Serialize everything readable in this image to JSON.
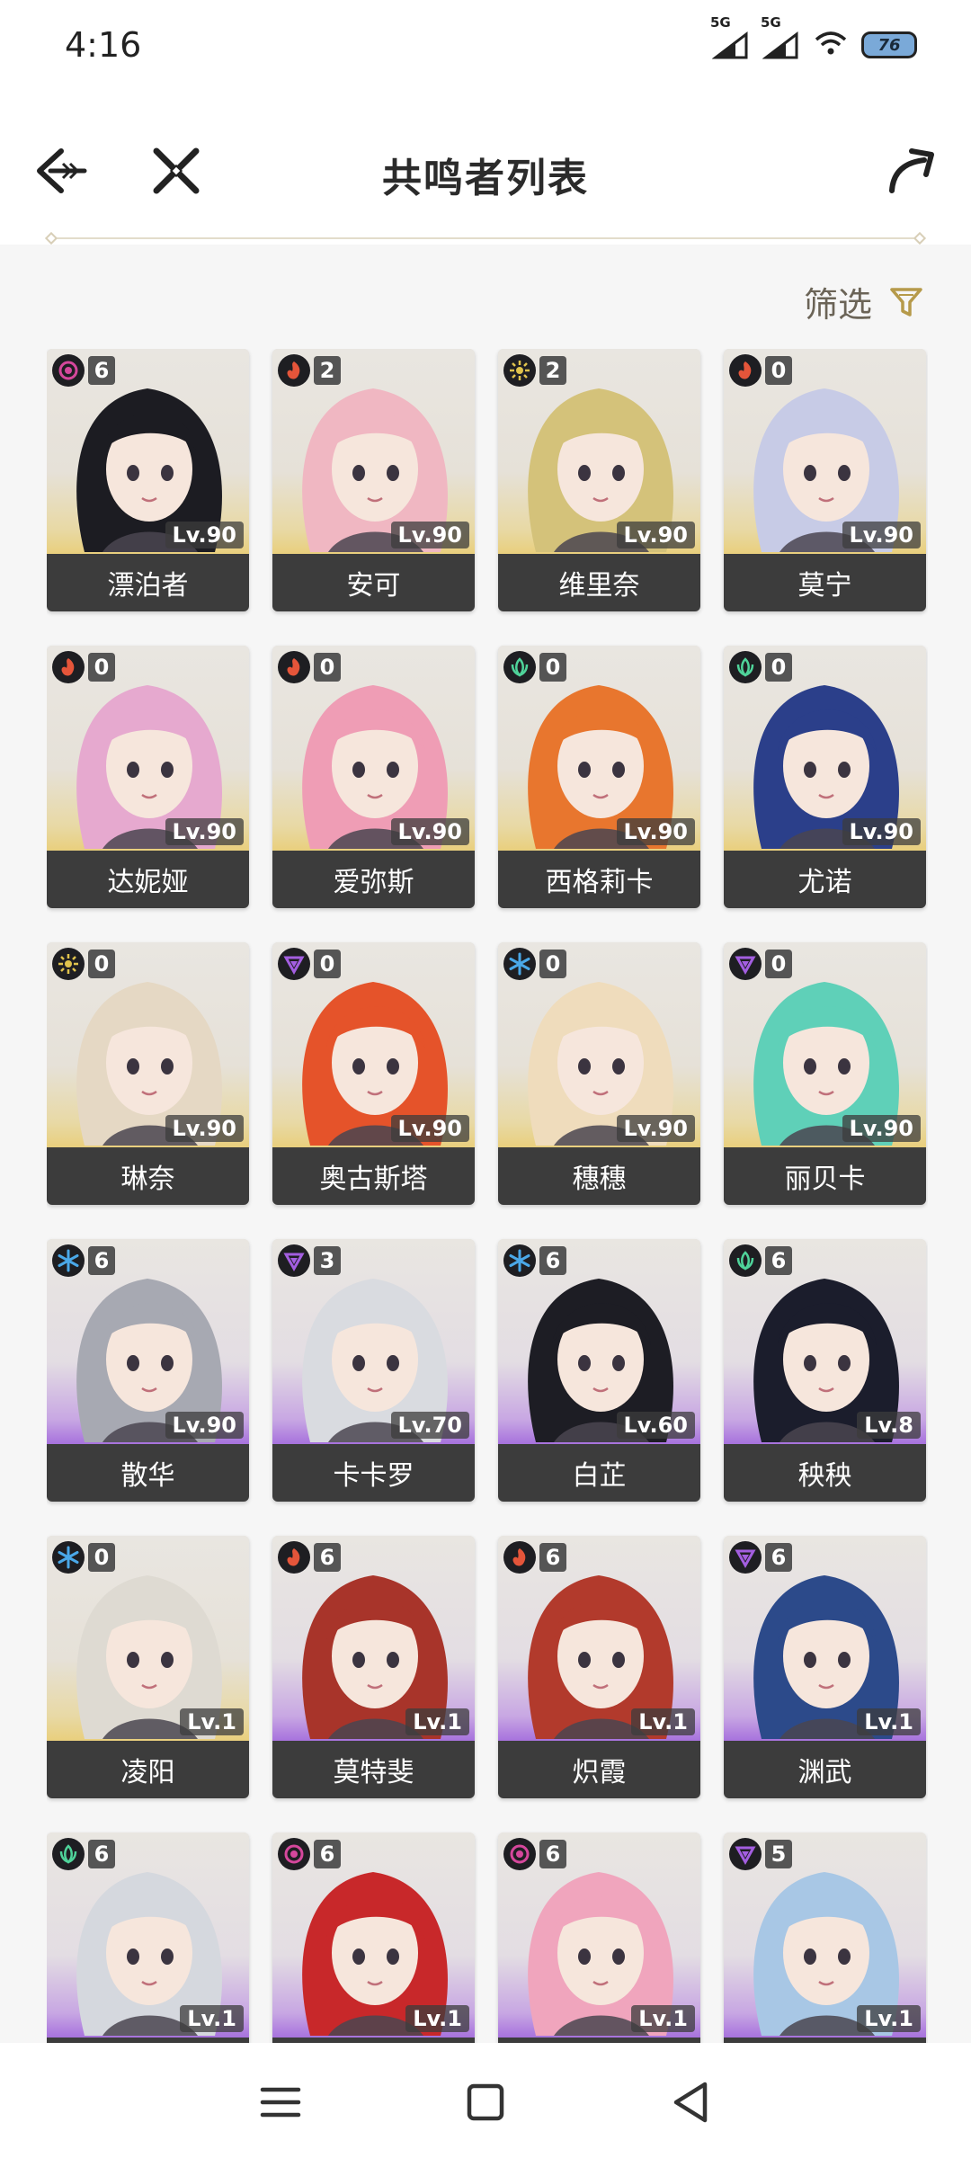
{
  "status": {
    "time": "4:16",
    "signal1_tag": "5G",
    "signal2_tag": "5G",
    "battery": "76"
  },
  "header": {
    "title": "共鸣者列表"
  },
  "filter": {
    "label": "筛选"
  },
  "icons": {
    "back": "back-arrow-icon",
    "close": "close-icon",
    "share": "share-icon",
    "filter": "filter-icon"
  },
  "colors": {
    "gold_gradient": "#e9cf7d",
    "purple_gradient": "#a772dd",
    "name_bar": "#3c3c3c",
    "accent": "#b69a4a"
  },
  "characters": [
    {
      "name": "漂泊者",
      "element": "havoc",
      "sequence": "6",
      "level": "Lv.90",
      "rarity": "gold",
      "hair": "#1c1c22"
    },
    {
      "name": "安可",
      "element": "fusion",
      "sequence": "2",
      "level": "Lv.90",
      "rarity": "gold",
      "hair": "#f0b7c2"
    },
    {
      "name": "维里奈",
      "element": "spectro",
      "sequence": "2",
      "level": "Lv.90",
      "rarity": "gold",
      "hair": "#d4c27a"
    },
    {
      "name": "莫宁",
      "element": "fusion",
      "sequence": "0",
      "level": "Lv.90",
      "rarity": "gold",
      "hair": "#c7cbe6"
    },
    {
      "name": "达妮娅",
      "element": "fusion",
      "sequence": "0",
      "level": "Lv.90",
      "rarity": "gold",
      "hair": "#e6a9cf"
    },
    {
      "name": "爱弥斯",
      "element": "fusion",
      "sequence": "0",
      "level": "Lv.90",
      "rarity": "gold",
      "hair": "#ef9db5"
    },
    {
      "name": "西格莉卡",
      "element": "aero",
      "sequence": "0",
      "level": "Lv.90",
      "rarity": "gold",
      "hair": "#e8762e"
    },
    {
      "name": "尤诺",
      "element": "aero",
      "sequence": "0",
      "level": "Lv.90",
      "rarity": "gold",
      "hair": "#2b3f8a"
    },
    {
      "name": "琳奈",
      "element": "spectro",
      "sequence": "0",
      "level": "Lv.90",
      "rarity": "gold",
      "hair": "#e5d8c4"
    },
    {
      "name": "奥古斯塔",
      "element": "electro",
      "sequence": "0",
      "level": "Lv.90",
      "rarity": "gold",
      "hair": "#e5532a"
    },
    {
      "name": "穗穗",
      "element": "glacio",
      "sequence": "0",
      "level": "Lv.90",
      "rarity": "gold",
      "hair": "#efdcbc"
    },
    {
      "name": "丽贝卡",
      "element": "electro",
      "sequence": "0",
      "level": "Lv.90",
      "rarity": "gold",
      "hair": "#5fd0b8"
    },
    {
      "name": "散华",
      "element": "glacio",
      "sequence": "6",
      "level": "Lv.90",
      "rarity": "purple",
      "hair": "#a7a9b2"
    },
    {
      "name": "卡卡罗",
      "element": "electro",
      "sequence": "3",
      "level": "Lv.70",
      "rarity": "purple",
      "hair": "#d9dbe0"
    },
    {
      "name": "白芷",
      "element": "glacio",
      "sequence": "6",
      "level": "Lv.60",
      "rarity": "purple",
      "hair": "#1d1d24"
    },
    {
      "name": "秧秧",
      "element": "aero",
      "sequence": "6",
      "level": "Lv.8",
      "rarity": "purple",
      "hair": "#1b1d2c"
    },
    {
      "name": "凌阳",
      "element": "glacio",
      "sequence": "0",
      "level": "Lv.1",
      "rarity": "gold",
      "hair": "#dedad2"
    },
    {
      "name": "莫特斐",
      "element": "fusion",
      "sequence": "6",
      "level": "Lv.1",
      "rarity": "purple",
      "hair": "#a8342a"
    },
    {
      "name": "炽霞",
      "element": "fusion",
      "sequence": "6",
      "level": "Lv.1",
      "rarity": "purple",
      "hair": "#b23a2c"
    },
    {
      "name": "渊武",
      "element": "electro",
      "sequence": "6",
      "level": "Lv.1",
      "rarity": "purple",
      "hair": "#2c4a8a"
    },
    {
      "name": "",
      "element": "aero",
      "sequence": "6",
      "level": "Lv.1",
      "rarity": "purple",
      "hair": "#d5d8de"
    },
    {
      "name": "",
      "element": "havoc",
      "sequence": "6",
      "level": "Lv.1",
      "rarity": "purple",
      "hair": "#c8282a"
    },
    {
      "name": "",
      "element": "havoc",
      "sequence": "6",
      "level": "Lv.1",
      "rarity": "purple",
      "hair": "#f0a5bd"
    },
    {
      "name": "",
      "element": "electro",
      "sequence": "5",
      "level": "Lv.1",
      "rarity": "purple",
      "hair": "#a8c7e5"
    }
  ],
  "navbar": {
    "menu": "menu-icon",
    "home": "home-square-icon",
    "back": "back-triangle-icon"
  }
}
